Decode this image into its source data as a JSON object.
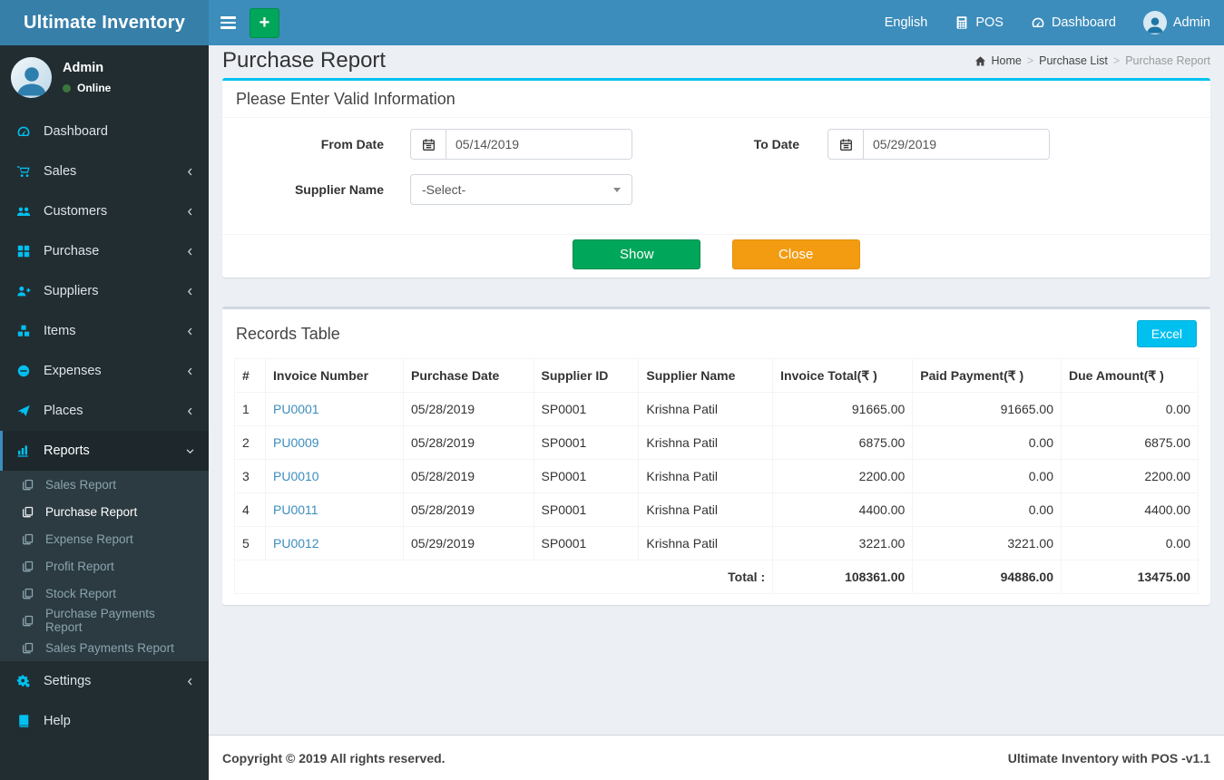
{
  "navbar": {
    "brand": "Ultimate Inventory",
    "plus": "+",
    "language": "English",
    "pos": "POS",
    "dashboard": "Dashboard",
    "user": "Admin"
  },
  "sidebar": {
    "user_name": "Admin",
    "user_status": "Online",
    "items": [
      {
        "label": "Dashboard"
      },
      {
        "label": "Sales"
      },
      {
        "label": "Customers"
      },
      {
        "label": "Purchase"
      },
      {
        "label": "Suppliers"
      },
      {
        "label": "Items"
      },
      {
        "label": "Expenses"
      },
      {
        "label": "Places"
      },
      {
        "label": "Reports"
      },
      {
        "label": "Settings"
      },
      {
        "label": "Help"
      }
    ],
    "reports_submenu": [
      {
        "label": "Sales Report"
      },
      {
        "label": "Purchase Report"
      },
      {
        "label": "Expense Report"
      },
      {
        "label": "Profit Report"
      },
      {
        "label": "Stock Report"
      },
      {
        "label": "Purchase Payments Report"
      },
      {
        "label": "Sales Payments Report"
      }
    ]
  },
  "page": {
    "title": "Purchase Report",
    "breadcrumb": {
      "home": "Home",
      "mid": "Purchase List",
      "current": "Purchase Report",
      "sep": ">"
    }
  },
  "filter_box": {
    "title": "Please Enter Valid Information",
    "from_date_label": "From Date",
    "from_date_value": "05/14/2019",
    "to_date_label": "To Date",
    "to_date_value": "05/29/2019",
    "supplier_label": "Supplier Name",
    "supplier_value": "-Select-",
    "show_button": "Show",
    "close_button": "Close"
  },
  "records_box": {
    "title": "Records Table",
    "excel_button": "Excel",
    "table": {
      "headers": [
        "#",
        "Invoice Number",
        "Purchase Date",
        "Supplier ID",
        "Supplier Name",
        "Invoice Total(₹ )",
        "Paid Payment(₹ )",
        "Due Amount(₹ )"
      ],
      "rows": [
        {
          "num": "1",
          "invoice": "PU0001",
          "date": "05/28/2019",
          "supplier_id": "SP0001",
          "supplier_name": "Krishna Patil",
          "invoice_total": "91665.00",
          "paid": "91665.00",
          "due": "0.00"
        },
        {
          "num": "2",
          "invoice": "PU0009",
          "date": "05/28/2019",
          "supplier_id": "SP0001",
          "supplier_name": "Krishna Patil",
          "invoice_total": "6875.00",
          "paid": "0.00",
          "due": "6875.00"
        },
        {
          "num": "3",
          "invoice": "PU0010",
          "date": "05/28/2019",
          "supplier_id": "SP0001",
          "supplier_name": "Krishna Patil",
          "invoice_total": "2200.00",
          "paid": "0.00",
          "due": "2200.00"
        },
        {
          "num": "4",
          "invoice": "PU0011",
          "date": "05/28/2019",
          "supplier_id": "SP0001",
          "supplier_name": "Krishna Patil",
          "invoice_total": "4400.00",
          "paid": "0.00",
          "due": "4400.00"
        },
        {
          "num": "5",
          "invoice": "PU0012",
          "date": "05/29/2019",
          "supplier_id": "SP0001",
          "supplier_name": "Krishna Patil",
          "invoice_total": "3221.00",
          "paid": "3221.00",
          "due": "0.00"
        }
      ],
      "total_label": "Total :",
      "totals": {
        "invoice_total": "108361.00",
        "paid": "94886.00",
        "due": "13475.00"
      }
    }
  },
  "footer": {
    "copyright": "Copyright © 2019 All rights reserved.",
    "version": "Ultimate Inventory with POS -v1.1"
  },
  "colors": {
    "navbar_blue": "#3c8dbc",
    "logo_blue": "#367fa9",
    "sidebar_dark": "#222d32",
    "accent_cyan": "#00c0ef",
    "button_green": "#00a65a",
    "button_orange": "#f39c12",
    "link_blue": "#3c8dbc"
  }
}
